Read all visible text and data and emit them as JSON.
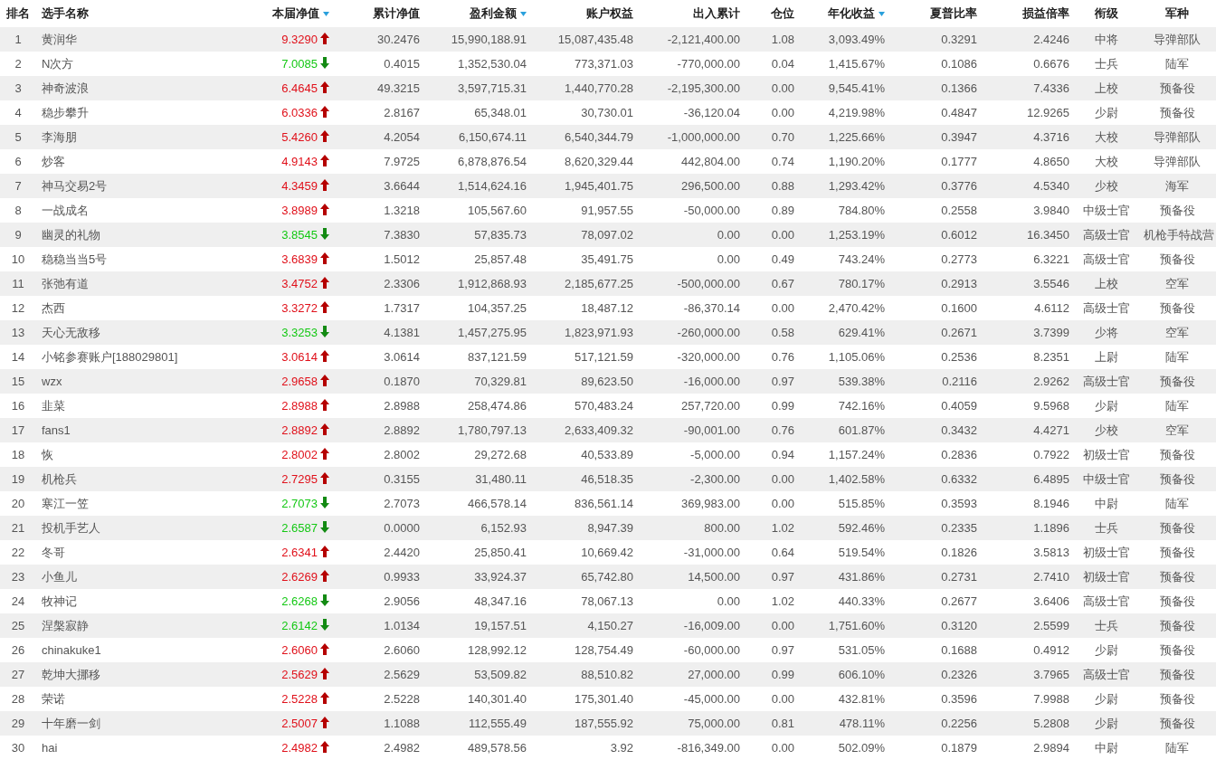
{
  "table": {
    "columns": [
      {
        "label": "排名",
        "sorted": false
      },
      {
        "label": "选手名称",
        "sorted": false
      },
      {
        "label": "本届净值",
        "sorted": true
      },
      {
        "label": "累计净值",
        "sorted": false
      },
      {
        "label": "盈利金额",
        "sorted": true
      },
      {
        "label": "账户权益",
        "sorted": false
      },
      {
        "label": "出入累计",
        "sorted": false
      },
      {
        "label": "仓位",
        "sorted": false
      },
      {
        "label": "年化收益",
        "sorted": true
      },
      {
        "label": "夏普比率",
        "sorted": false
      },
      {
        "label": "损益倍率",
        "sorted": false
      },
      {
        "label": "衔级",
        "sorted": false
      },
      {
        "label": "军种",
        "sorted": false
      }
    ],
    "rows": [
      {
        "rising": true,
        "cells": [
          "1",
          "黄润华",
          "9.3290",
          "30.2476",
          "15,990,188.91",
          "15,087,435.48",
          "-2,121,400.00",
          "1.08",
          "3,093.49%",
          "0.3291",
          "2.4246",
          "中将",
          "导弹部队"
        ]
      },
      {
        "rising": false,
        "cells": [
          "2",
          "N次方",
          "7.0085",
          "0.4015",
          "1,352,530.04",
          "773,371.03",
          "-770,000.00",
          "0.04",
          "1,415.67%",
          "0.1086",
          "0.6676",
          "士兵",
          "陆军"
        ]
      },
      {
        "rising": true,
        "cells": [
          "3",
          "神奇波浪",
          "6.4645",
          "49.3215",
          "3,597,715.31",
          "1,440,770.28",
          "-2,195,300.00",
          "0.00",
          "9,545.41%",
          "0.1366",
          "7.4336",
          "上校",
          "预备役"
        ]
      },
      {
        "rising": true,
        "cells": [
          "4",
          "稳步攀升",
          "6.0336",
          "2.8167",
          "65,348.01",
          "30,730.01",
          "-36,120.04",
          "0.00",
          "4,219.98%",
          "0.4847",
          "12.9265",
          "少尉",
          "预备役"
        ]
      },
      {
        "rising": true,
        "cells": [
          "5",
          "李海朋",
          "5.4260",
          "4.2054",
          "6,150,674.11",
          "6,540,344.79",
          "-1,000,000.00",
          "0.70",
          "1,225.66%",
          "0.3947",
          "4.3716",
          "大校",
          "导弹部队"
        ]
      },
      {
        "rising": true,
        "cells": [
          "6",
          "炒客",
          "4.9143",
          "7.9725",
          "6,878,876.54",
          "8,620,329.44",
          "442,804.00",
          "0.74",
          "1,190.20%",
          "0.1777",
          "4.8650",
          "大校",
          "导弹部队"
        ]
      },
      {
        "rising": true,
        "cells": [
          "7",
          "神马交易2号",
          "4.3459",
          "3.6644",
          "1,514,624.16",
          "1,945,401.75",
          "296,500.00",
          "0.88",
          "1,293.42%",
          "0.3776",
          "4.5340",
          "少校",
          "海军"
        ]
      },
      {
        "rising": true,
        "cells": [
          "8",
          "一战成名",
          "3.8989",
          "1.3218",
          "105,567.60",
          "91,957.55",
          "-50,000.00",
          "0.89",
          "784.80%",
          "0.2558",
          "3.9840",
          "中级士官",
          "预备役"
        ]
      },
      {
        "rising": false,
        "cells": [
          "9",
          "幽灵的礼物",
          "3.8545",
          "7.3830",
          "57,835.73",
          "78,097.02",
          "0.00",
          "0.00",
          "1,253.19%",
          "0.6012",
          "16.3450",
          "高级士官",
          "机枪手特战营"
        ]
      },
      {
        "rising": true,
        "cells": [
          "10",
          "稳稳当当5号",
          "3.6839",
          "1.5012",
          "25,857.48",
          "35,491.75",
          "0.00",
          "0.49",
          "743.24%",
          "0.2773",
          "6.3221",
          "高级士官",
          "预备役"
        ]
      },
      {
        "rising": true,
        "cells": [
          "11",
          "张弛有道",
          "3.4752",
          "2.3306",
          "1,912,868.93",
          "2,185,677.25",
          "-500,000.00",
          "0.67",
          "780.17%",
          "0.2913",
          "3.5546",
          "上校",
          "空军"
        ]
      },
      {
        "rising": true,
        "cells": [
          "12",
          "杰西",
          "3.3272",
          "1.7317",
          "104,357.25",
          "18,487.12",
          "-86,370.14",
          "0.00",
          "2,470.42%",
          "0.1600",
          "4.6112",
          "高级士官",
          "预备役"
        ]
      },
      {
        "rising": false,
        "cells": [
          "13",
          "天心无敌移",
          "3.3253",
          "4.1381",
          "1,457,275.95",
          "1,823,971.93",
          "-260,000.00",
          "0.58",
          "629.41%",
          "0.2671",
          "3.7399",
          "少将",
          "空军"
        ]
      },
      {
        "rising": true,
        "cells": [
          "14",
          "小铭参赛账户[188029801]",
          "3.0614",
          "3.0614",
          "837,121.59",
          "517,121.59",
          "-320,000.00",
          "0.76",
          "1,105.06%",
          "0.2536",
          "8.2351",
          "上尉",
          "陆军"
        ]
      },
      {
        "rising": true,
        "cells": [
          "15",
          "wzx",
          "2.9658",
          "0.1870",
          "70,329.81",
          "89,623.50",
          "-16,000.00",
          "0.97",
          "539.38%",
          "0.2116",
          "2.9262",
          "高级士官",
          "预备役"
        ]
      },
      {
        "rising": true,
        "cells": [
          "16",
          "韭菜",
          "2.8988",
          "2.8988",
          "258,474.86",
          "570,483.24",
          "257,720.00",
          "0.99",
          "742.16%",
          "0.4059",
          "9.5968",
          "少尉",
          "陆军"
        ]
      },
      {
        "rising": true,
        "cells": [
          "17",
          "fans1",
          "2.8892",
          "2.8892",
          "1,780,797.13",
          "2,633,409.32",
          "-90,001.00",
          "0.76",
          "601.87%",
          "0.3432",
          "4.4271",
          "少校",
          "空军"
        ]
      },
      {
        "rising": true,
        "cells": [
          "18",
          "恢",
          "2.8002",
          "2.8002",
          "29,272.68",
          "40,533.89",
          "-5,000.00",
          "0.94",
          "1,157.24%",
          "0.2836",
          "0.7922",
          "初级士官",
          "预备役"
        ]
      },
      {
        "rising": true,
        "cells": [
          "19",
          "机枪兵",
          "2.7295",
          "0.3155",
          "31,480.11",
          "46,518.35",
          "-2,300.00",
          "0.00",
          "1,402.58%",
          "0.6332",
          "6.4895",
          "中级士官",
          "预备役"
        ]
      },
      {
        "rising": false,
        "cells": [
          "20",
          "寒江一笠",
          "2.7073",
          "2.7073",
          "466,578.14",
          "836,561.14",
          "369,983.00",
          "0.00",
          "515.85%",
          "0.3593",
          "8.1946",
          "中尉",
          "陆军"
        ]
      },
      {
        "rising": false,
        "cells": [
          "21",
          "投机手艺人",
          "2.6587",
          "0.0000",
          "6,152.93",
          "8,947.39",
          "800.00",
          "1.02",
          "592.46%",
          "0.2335",
          "1.1896",
          "士兵",
          "预备役"
        ]
      },
      {
        "rising": true,
        "cells": [
          "22",
          "冬哥",
          "2.6341",
          "2.4420",
          "25,850.41",
          "10,669.42",
          "-31,000.00",
          "0.64",
          "519.54%",
          "0.1826",
          "3.5813",
          "初级士官",
          "预备役"
        ]
      },
      {
        "rising": true,
        "cells": [
          "23",
          "小鱼儿",
          "2.6269",
          "0.9933",
          "33,924.37",
          "65,742.80",
          "14,500.00",
          "0.97",
          "431.86%",
          "0.2731",
          "2.7410",
          "初级士官",
          "预备役"
        ]
      },
      {
        "rising": false,
        "cells": [
          "24",
          "牧神记",
          "2.6268",
          "2.9056",
          "48,347.16",
          "78,067.13",
          "0.00",
          "1.02",
          "440.33%",
          "0.2677",
          "3.6406",
          "高级士官",
          "预备役"
        ]
      },
      {
        "rising": false,
        "cells": [
          "25",
          "涅槃寂静",
          "2.6142",
          "1.0134",
          "19,157.51",
          "4,150.27",
          "-16,009.00",
          "0.00",
          "1,751.60%",
          "0.3120",
          "2.5599",
          "士兵",
          "预备役"
        ]
      },
      {
        "rising": true,
        "cells": [
          "26",
          "chinakuke1",
          "2.6060",
          "2.6060",
          "128,992.12",
          "128,754.49",
          "-60,000.00",
          "0.97",
          "531.05%",
          "0.1688",
          "0.4912",
          "少尉",
          "预备役"
        ]
      },
      {
        "rising": true,
        "cells": [
          "27",
          "乾坤大挪移",
          "2.5629",
          "2.5629",
          "53,509.82",
          "88,510.82",
          "27,000.00",
          "0.99",
          "606.10%",
          "0.2326",
          "3.7965",
          "高级士官",
          "预备役"
        ]
      },
      {
        "rising": true,
        "cells": [
          "28",
          "荣诺",
          "2.5228",
          "2.5228",
          "140,301.40",
          "175,301.40",
          "-45,000.00",
          "0.00",
          "432.81%",
          "0.3596",
          "7.9988",
          "少尉",
          "预备役"
        ]
      },
      {
        "rising": true,
        "cells": [
          "29",
          "十年磨一剑",
          "2.5007",
          "1.1088",
          "112,555.49",
          "187,555.92",
          "75,000.00",
          "0.81",
          "478.11%",
          "0.2256",
          "5.2808",
          "少尉",
          "预备役"
        ]
      },
      {
        "rising": true,
        "cells": [
          "30",
          "hai",
          "2.4982",
          "2.4982",
          "489,578.56",
          "3.92",
          "-816,349.00",
          "0.00",
          "502.09%",
          "0.1879",
          "2.9894",
          "中尉",
          "陆军"
        ]
      }
    ]
  }
}
